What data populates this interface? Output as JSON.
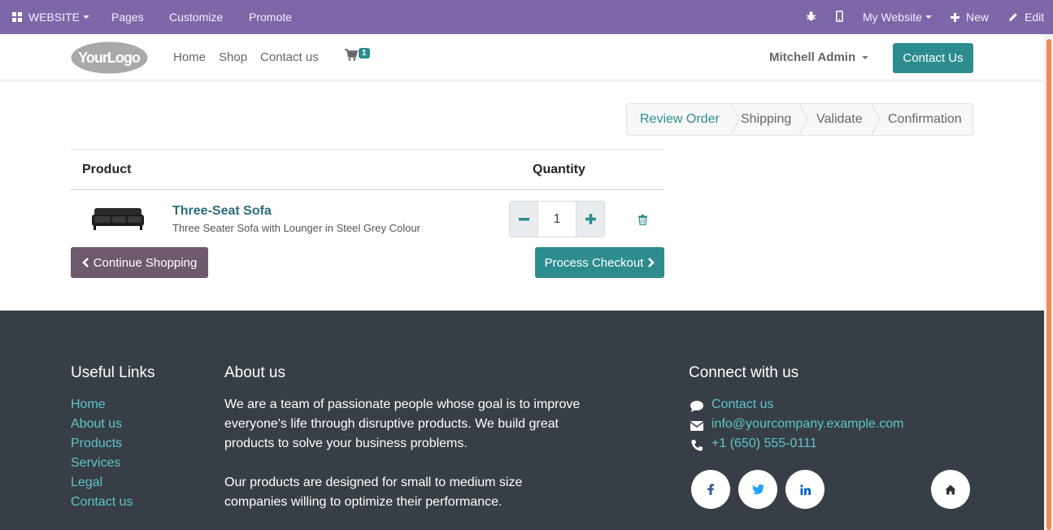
{
  "adminbar": {
    "website_label": "WEBSITE",
    "pages": "Pages",
    "customize": "Customize",
    "promote": "Promote",
    "my_website": "My Website",
    "new": "New",
    "edit": "Edit"
  },
  "header": {
    "logo_text": "YourLogo",
    "nav": [
      "Home",
      "Shop",
      "Contact us"
    ],
    "cart_count": "1",
    "user": "Mitchell Admin",
    "contact_button": "Contact Us"
  },
  "steps": [
    "Review Order",
    "Shipping",
    "Validate",
    "Confirmation"
  ],
  "cart": {
    "col_product": "Product",
    "col_quantity": "Quantity",
    "items": [
      {
        "name": "Three-Seat Sofa",
        "description": "Three Seater Sofa with Lounger in Steel Grey Colour",
        "quantity": "1"
      }
    ],
    "continue_label": "Continue Shopping",
    "checkout_label": "Process Checkout"
  },
  "footer": {
    "useful_links_title": "Useful Links",
    "useful_links": [
      "Home",
      "About us",
      "Products",
      "Services",
      "Legal",
      "Contact us"
    ],
    "about_title": "About us",
    "about_p1_lines": [
      "We are a team of passionate people whose goal is to improve",
      "everyone's life through disruptive products. We build great",
      "products to solve your business problems."
    ],
    "about_p2_lines": [
      "Our products are designed for small to medium size",
      "companies willing to optimize their performance."
    ],
    "connect_title": "Connect with us",
    "contact_link": "Contact us",
    "email": "info@yourcompany.example.com",
    "phone": "+1 (650) 555-0111",
    "social": [
      "facebook-icon",
      "twitter-icon",
      "linkedin-icon",
      "home-icon"
    ]
  },
  "colors": {
    "adminbar": "#7e67a8",
    "primary": "#2d8c8e",
    "secondary": "#6e5a6c",
    "footer_bg": "#383e45",
    "footer_link": "#5bc6cf"
  }
}
